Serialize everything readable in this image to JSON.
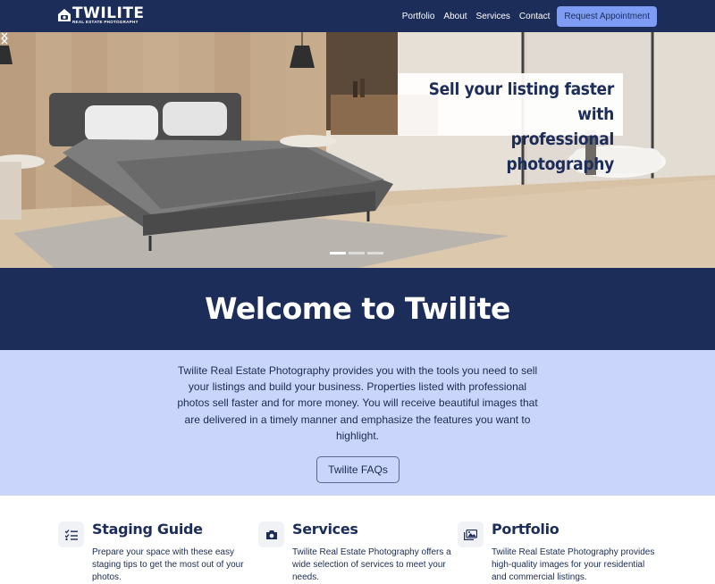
{
  "navbar": {
    "logo_text": "TWILITE",
    "logo_subtext": "REAL ESTATE PHOTOGRAPHY",
    "links": [
      "Portfolio",
      "About",
      "Services",
      "Contact"
    ],
    "cta_label": "Request Appointment"
  },
  "hero": {
    "caption_line1": "Sell your listing faster with",
    "caption_line2": "professional photography",
    "prev_icon": "chevron-left-icon",
    "next_icon": "chevron-right-icon",
    "slide_count": 3,
    "active_slide": 1
  },
  "welcome": {
    "title": "Welcome to Twilite"
  },
  "intro": {
    "text": "Twilite Real Estate Photography provides you with the tools you need to sell your listings and build your business. Properties listed with professional photos sell faster and for more money. You will receive beautiful images that are delivered in a timely manner and emphasize the features you want to highlight.",
    "button_label": "Twilite FAQs"
  },
  "cards": [
    {
      "icon": "checklist-icon",
      "title": "Staging Guide",
      "text": "Prepare your space with these easy staging tips to get the most out of your photos."
    },
    {
      "icon": "camera-icon",
      "title": "Services",
      "text": "Twilite Real Estate Photography offers a wide selection of services to meet your needs."
    },
    {
      "icon": "images-icon",
      "title": "Portfolio",
      "text": "Twilite Real Estate Photography provides high-quality images for your residential and commercial listings."
    }
  ],
  "colors": {
    "navy": "#1c2d5a",
    "accent": "#7f9cf5",
    "intro_bg": "#c9d5fb"
  }
}
